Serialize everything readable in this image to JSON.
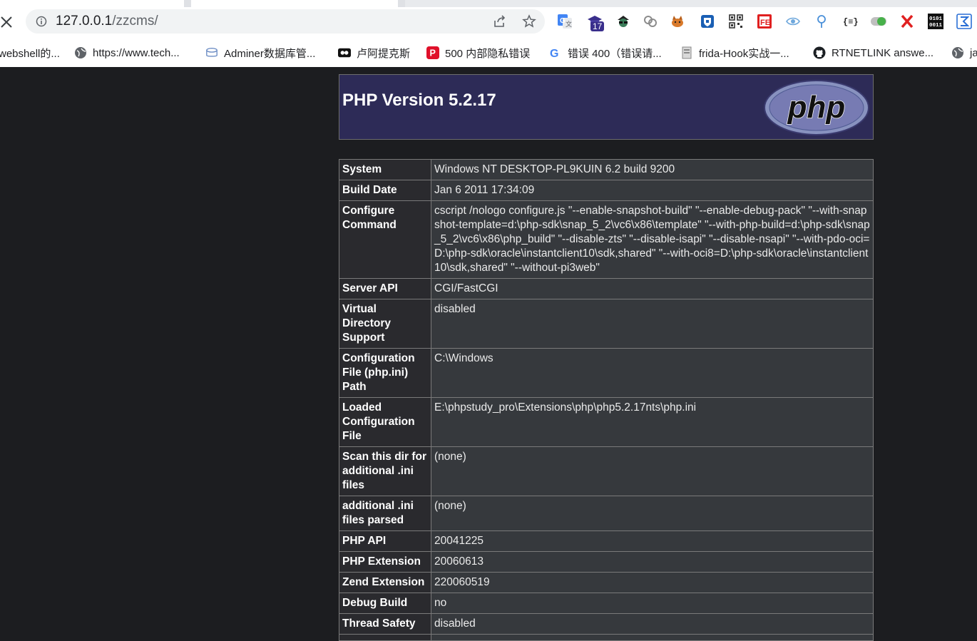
{
  "browser": {
    "address_bar": {
      "host": "127.0.0.1",
      "path": "/zzcms/"
    },
    "extensions": [
      {
        "icon": "translate-icon"
      },
      {
        "icon": "graduation-cap-icon",
        "badge": "17"
      },
      {
        "icon": "spy-icon"
      },
      {
        "icon": "link-chain-icon"
      },
      {
        "icon": "cat-icon"
      },
      {
        "icon": "shield-icon"
      },
      {
        "icon": "qr-code-icon"
      },
      {
        "icon": "fe-icon",
        "text": "FE"
      },
      {
        "icon": "eye-icon"
      },
      {
        "icon": "location-pin-icon"
      },
      {
        "icon": "json-icon",
        "text": "{≡}"
      },
      {
        "icon": "toggle-icon"
      },
      {
        "icon": "x-icon",
        "text": "X"
      },
      {
        "icon": "binary-icon",
        "text": "0101\n0011"
      },
      {
        "icon": "sigma-icon",
        "text": "Σ"
      }
    ],
    "bookmarks": [
      {
        "label": "webshell的...",
        "icon": "doc-icon"
      },
      {
        "label": "https://www.tech...",
        "icon": "globe-icon"
      },
      {
        "label": "Adminer数据库管...",
        "icon": "adminer-icon"
      },
      {
        "label": "卢阿提克斯",
        "icon": "media-icon"
      },
      {
        "label": "500 内部隐私错误",
        "icon": "p-icon"
      },
      {
        "label": "错误 400（错误请...",
        "icon": "google-icon"
      },
      {
        "label": "frida-Hook实战一...",
        "icon": "page-icon"
      },
      {
        "label": "RTNETLINK answe...",
        "icon": "github-icon"
      },
      {
        "label": "ja",
        "icon": "globe-icon"
      }
    ]
  },
  "phpinfo": {
    "title": "PHP Version 5.2.17",
    "logo_text": "php",
    "rows": [
      {
        "key": "System",
        "value": "Windows NT DESKTOP-PL9KUIN 6.2 build 9200"
      },
      {
        "key": "Build Date",
        "value": "Jan 6 2011 17:34:09"
      },
      {
        "key": "Configure Command",
        "value": "cscript /nologo configure.js \"--enable-snapshot-build\" \"--enable-debug-pack\" \"--with-snapshot-template=d:\\php-sdk\\snap_5_2\\vc6\\x86\\template\" \"--with-php-build=d:\\php-sdk\\snap_5_2\\vc6\\x86\\php_build\" \"--disable-zts\" \"--disable-isapi\" \"--disable-nsapi\" \"--with-pdo-oci=D:\\php-sdk\\oracle\\instantclient10\\sdk,shared\" \"--with-oci8=D:\\php-sdk\\oracle\\instantclient10\\sdk,shared\" \"--without-pi3web\""
      },
      {
        "key": "Server API",
        "value": "CGI/FastCGI"
      },
      {
        "key": "Virtual Directory Support",
        "value": "disabled"
      },
      {
        "key": "Configuration File (php.ini) Path",
        "value": "C:\\Windows"
      },
      {
        "key": "Loaded Configuration File",
        "value": "E:\\phpstudy_pro\\Extensions\\php\\php5.2.17nts\\php.ini"
      },
      {
        "key": "Scan this dir for additional .ini files",
        "value": "(none)"
      },
      {
        "key": "additional .ini files parsed",
        "value": "(none)"
      },
      {
        "key": "PHP API",
        "value": "20041225"
      },
      {
        "key": "PHP Extension",
        "value": "20060613"
      },
      {
        "key": "Zend Extension",
        "value": "220060519"
      },
      {
        "key": "Debug Build",
        "value": "no"
      },
      {
        "key": "Thread Safety",
        "value": "disabled"
      },
      {
        "key": "",
        "value": ""
      }
    ]
  }
}
